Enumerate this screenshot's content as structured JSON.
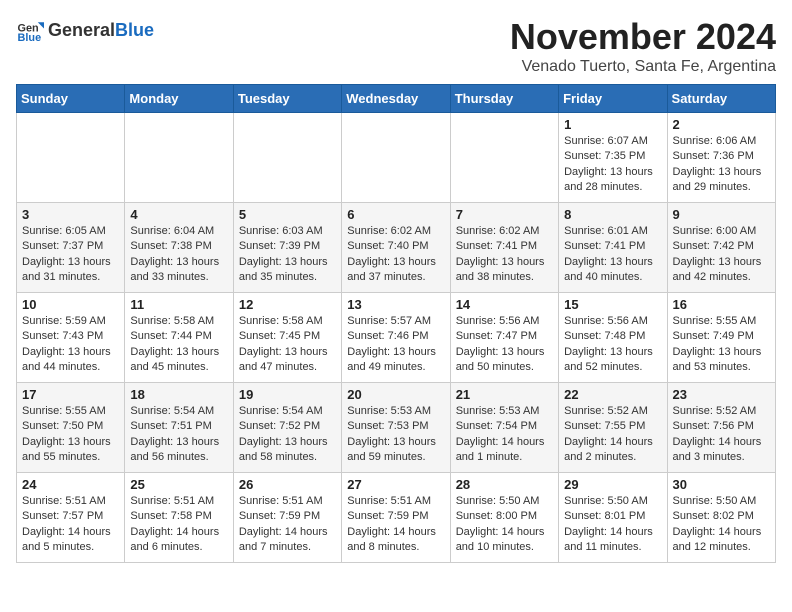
{
  "logo": {
    "general": "General",
    "blue": "Blue"
  },
  "title": "November 2024",
  "subtitle": "Venado Tuerto, Santa Fe, Argentina",
  "days_header": [
    "Sunday",
    "Monday",
    "Tuesday",
    "Wednesday",
    "Thursday",
    "Friday",
    "Saturday"
  ],
  "weeks": [
    [
      {
        "day": "",
        "info": ""
      },
      {
        "day": "",
        "info": ""
      },
      {
        "day": "",
        "info": ""
      },
      {
        "day": "",
        "info": ""
      },
      {
        "day": "",
        "info": ""
      },
      {
        "day": "1",
        "info": "Sunrise: 6:07 AM\nSunset: 7:35 PM\nDaylight: 13 hours\nand 28 minutes."
      },
      {
        "day": "2",
        "info": "Sunrise: 6:06 AM\nSunset: 7:36 PM\nDaylight: 13 hours\nand 29 minutes."
      }
    ],
    [
      {
        "day": "3",
        "info": "Sunrise: 6:05 AM\nSunset: 7:37 PM\nDaylight: 13 hours\nand 31 minutes."
      },
      {
        "day": "4",
        "info": "Sunrise: 6:04 AM\nSunset: 7:38 PM\nDaylight: 13 hours\nand 33 minutes."
      },
      {
        "day": "5",
        "info": "Sunrise: 6:03 AM\nSunset: 7:39 PM\nDaylight: 13 hours\nand 35 minutes."
      },
      {
        "day": "6",
        "info": "Sunrise: 6:02 AM\nSunset: 7:40 PM\nDaylight: 13 hours\nand 37 minutes."
      },
      {
        "day": "7",
        "info": "Sunrise: 6:02 AM\nSunset: 7:41 PM\nDaylight: 13 hours\nand 38 minutes."
      },
      {
        "day": "8",
        "info": "Sunrise: 6:01 AM\nSunset: 7:41 PM\nDaylight: 13 hours\nand 40 minutes."
      },
      {
        "day": "9",
        "info": "Sunrise: 6:00 AM\nSunset: 7:42 PM\nDaylight: 13 hours\nand 42 minutes."
      }
    ],
    [
      {
        "day": "10",
        "info": "Sunrise: 5:59 AM\nSunset: 7:43 PM\nDaylight: 13 hours\nand 44 minutes."
      },
      {
        "day": "11",
        "info": "Sunrise: 5:58 AM\nSunset: 7:44 PM\nDaylight: 13 hours\nand 45 minutes."
      },
      {
        "day": "12",
        "info": "Sunrise: 5:58 AM\nSunset: 7:45 PM\nDaylight: 13 hours\nand 47 minutes."
      },
      {
        "day": "13",
        "info": "Sunrise: 5:57 AM\nSunset: 7:46 PM\nDaylight: 13 hours\nand 49 minutes."
      },
      {
        "day": "14",
        "info": "Sunrise: 5:56 AM\nSunset: 7:47 PM\nDaylight: 13 hours\nand 50 minutes."
      },
      {
        "day": "15",
        "info": "Sunrise: 5:56 AM\nSunset: 7:48 PM\nDaylight: 13 hours\nand 52 minutes."
      },
      {
        "day": "16",
        "info": "Sunrise: 5:55 AM\nSunset: 7:49 PM\nDaylight: 13 hours\nand 53 minutes."
      }
    ],
    [
      {
        "day": "17",
        "info": "Sunrise: 5:55 AM\nSunset: 7:50 PM\nDaylight: 13 hours\nand 55 minutes."
      },
      {
        "day": "18",
        "info": "Sunrise: 5:54 AM\nSunset: 7:51 PM\nDaylight: 13 hours\nand 56 minutes."
      },
      {
        "day": "19",
        "info": "Sunrise: 5:54 AM\nSunset: 7:52 PM\nDaylight: 13 hours\nand 58 minutes."
      },
      {
        "day": "20",
        "info": "Sunrise: 5:53 AM\nSunset: 7:53 PM\nDaylight: 13 hours\nand 59 minutes."
      },
      {
        "day": "21",
        "info": "Sunrise: 5:53 AM\nSunset: 7:54 PM\nDaylight: 14 hours\nand 1 minute."
      },
      {
        "day": "22",
        "info": "Sunrise: 5:52 AM\nSunset: 7:55 PM\nDaylight: 14 hours\nand 2 minutes."
      },
      {
        "day": "23",
        "info": "Sunrise: 5:52 AM\nSunset: 7:56 PM\nDaylight: 14 hours\nand 3 minutes."
      }
    ],
    [
      {
        "day": "24",
        "info": "Sunrise: 5:51 AM\nSunset: 7:57 PM\nDaylight: 14 hours\nand 5 minutes."
      },
      {
        "day": "25",
        "info": "Sunrise: 5:51 AM\nSunset: 7:58 PM\nDaylight: 14 hours\nand 6 minutes."
      },
      {
        "day": "26",
        "info": "Sunrise: 5:51 AM\nSunset: 7:59 PM\nDaylight: 14 hours\nand 7 minutes."
      },
      {
        "day": "27",
        "info": "Sunrise: 5:51 AM\nSunset: 7:59 PM\nDaylight: 14 hours\nand 8 minutes."
      },
      {
        "day": "28",
        "info": "Sunrise: 5:50 AM\nSunset: 8:00 PM\nDaylight: 14 hours\nand 10 minutes."
      },
      {
        "day": "29",
        "info": "Sunrise: 5:50 AM\nSunset: 8:01 PM\nDaylight: 14 hours\nand 11 minutes."
      },
      {
        "day": "30",
        "info": "Sunrise: 5:50 AM\nSunset: 8:02 PM\nDaylight: 14 hours\nand 12 minutes."
      }
    ]
  ]
}
